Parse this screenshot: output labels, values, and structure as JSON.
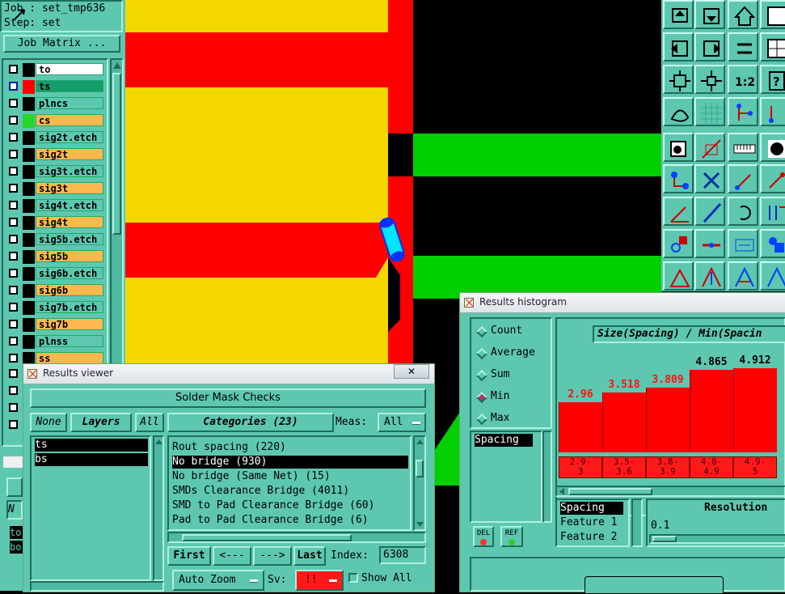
{
  "job": {
    "job_line": "Job : set_tmp636",
    "step_line": "Step: set",
    "matrix_button": "Job Matrix ..."
  },
  "layers": [
    {
      "name": "to",
      "color": "#ffffff",
      "swatch": "#000000"
    },
    {
      "name": "ts",
      "color": "#159d6c",
      "swatch": "#ff0000",
      "selected": true
    },
    {
      "name": "plncs",
      "color": "#5ec7b0",
      "swatch": "#000000"
    },
    {
      "name": "cs",
      "color": "#ffb84d",
      "swatch": "#27d62a"
    },
    {
      "name": "sig2t.etch",
      "color": "#5ec7b0",
      "swatch": "#000000"
    },
    {
      "name": "sig2t",
      "color": "#ffb84d",
      "swatch": "#000000"
    },
    {
      "name": "sig3t.etch",
      "color": "#5ec7b0",
      "swatch": "#000000"
    },
    {
      "name": "sig3t",
      "color": "#ffb84d",
      "swatch": "#000000"
    },
    {
      "name": "sig4t.etch",
      "color": "#5ec7b0",
      "swatch": "#000000"
    },
    {
      "name": "sig4t",
      "color": "#ffb84d",
      "swatch": "#000000"
    },
    {
      "name": "sig5b.etch",
      "color": "#5ec7b0",
      "swatch": "#000000"
    },
    {
      "name": "sig5b",
      "color": "#ffb84d",
      "swatch": "#000000"
    },
    {
      "name": "sig6b.etch",
      "color": "#5ec7b0",
      "swatch": "#000000"
    },
    {
      "name": "sig6b",
      "color": "#ffb84d",
      "swatch": "#000000"
    },
    {
      "name": "sig7b.etch",
      "color": "#5ec7b0",
      "swatch": "#000000"
    },
    {
      "name": "sig7b",
      "color": "#ffb84d",
      "swatch": "#000000"
    },
    {
      "name": "plnss",
      "color": "#5ec7b0",
      "swatch": "#000000"
    },
    {
      "name": "ss",
      "color": "#ffb84d",
      "swatch": "#000000"
    }
  ],
  "behind_window": {
    "items": [
      "N",
      "to",
      "bo"
    ]
  },
  "results_viewer": {
    "title": "Results viewer",
    "header": "Solder Mask Checks",
    "none_btn": "None",
    "layers_btn": "Layers",
    "all_btn": "All",
    "categories_btn": "Categories (23)",
    "meas_label": "Meas:",
    "meas_value": "All",
    "layer_list": [
      "ts",
      "bs"
    ],
    "categories": [
      "Rout spacing (220)",
      "No bridge (930)",
      "No bridge (Same Net) (15)",
      "SMDs Clearance Bridge (4011)",
      "SMD to Pad Clearance Bridge (60)",
      "Pad to Pad Clearance Bridge (6)"
    ],
    "selected_category": 1,
    "first_btn": "First",
    "prev_btn": "<---",
    "next_btn": "--->",
    "last_btn": "Last",
    "index_label": "Index:",
    "index_value": "6308",
    "zoom_value": "Auto Zoom",
    "sv_label": "Sv:",
    "sv_value": "!!",
    "show_all": "Show All",
    "close": "✕"
  },
  "histogram": {
    "title": "Results histogram",
    "options": [
      "Count",
      "Average",
      "Sum",
      "Min",
      "Max"
    ],
    "selected_option": "Min",
    "chart_title": "Size(Spacing) / Min(Spacin",
    "measure_list": [
      "Spacing"
    ],
    "del_btn": "DEL",
    "ref_btn": "REF",
    "bars": [
      {
        "value": "2.96",
        "range_top": "2.9-",
        "range_bottom": "3",
        "fraction": 0.31
      },
      {
        "value": "3.518",
        "range_top": "3.5-",
        "range_bottom": "3.6",
        "fraction": 0.37
      },
      {
        "value": "3.809",
        "range_top": "3.8-",
        "range_bottom": "3.9",
        "fraction": 0.4
      },
      {
        "value": "4.865",
        "range_top": "4.8-",
        "range_bottom": "4.9",
        "fraction": 0.51
      },
      {
        "value": "4.912",
        "range_top": "4.9-",
        "range_bottom": "5",
        "fraction": 0.52
      }
    ],
    "field_list": [
      "Spacing",
      "Feature 1",
      "Feature 2"
    ],
    "resolution_label": "Resolution",
    "resolution_value": "0.1"
  },
  "colors": {
    "teal": "#5ec7b0",
    "copper_yellow": "#f5d800",
    "copper_red": "#ff0000",
    "green": "#00d000"
  }
}
